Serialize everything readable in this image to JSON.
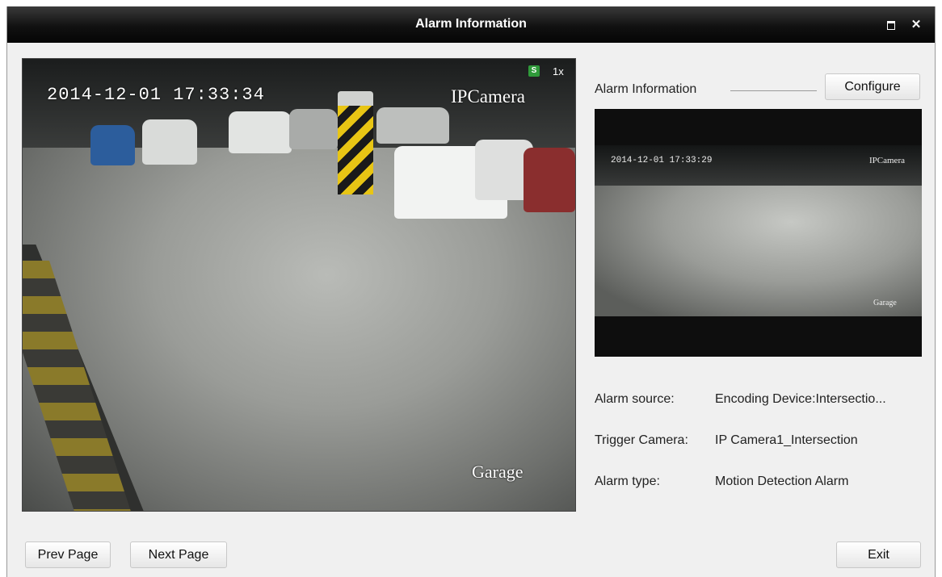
{
  "window": {
    "title": "Alarm Information"
  },
  "main_video": {
    "timestamp": "2014-12-01 17:33:34",
    "camera_name": "IPCamera",
    "location_label": "Garage",
    "zoom": "1x",
    "record_icon": "record-icon"
  },
  "info_panel": {
    "heading": "Alarm Information",
    "configure_label": "Configure",
    "thumbnail": {
      "timestamp": "2014-12-01 17:33:29",
      "camera_name": "IPCamera",
      "location_label": "Garage"
    },
    "rows": [
      {
        "label": "Alarm source:",
        "value": "Encoding Device:Intersectio..."
      },
      {
        "label": "Trigger Camera:",
        "value": "IP Camera1_Intersection"
      },
      {
        "label": "Alarm type:",
        "value": "Motion Detection Alarm"
      }
    ]
  },
  "footer": {
    "prev_label": "Prev Page",
    "next_label": "Next Page",
    "exit_label": "Exit"
  }
}
